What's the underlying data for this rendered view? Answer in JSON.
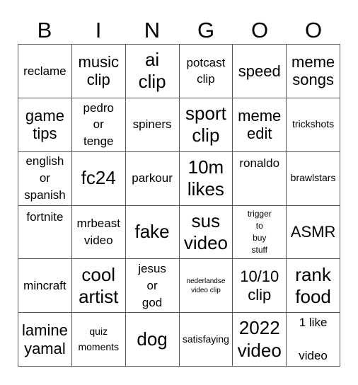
{
  "header": [
    "B",
    "I",
    "N",
    "G",
    "O",
    "O"
  ],
  "cells": [
    {
      "text": "reclame",
      "size": "m"
    },
    {
      "text": "music\nclip",
      "size": "l"
    },
    {
      "text": "ai\nclip",
      "size": "xl"
    },
    {
      "text": "potcast\nclip",
      "size": "m"
    },
    {
      "text": "speed",
      "size": "l"
    },
    {
      "text": "meme\nsongs",
      "size": "l"
    },
    {
      "text": "game\ntips",
      "size": "l"
    },
    {
      "text": "pedro\nor\ntenge",
      "size": "m"
    },
    {
      "text": "spiners",
      "size": "m"
    },
    {
      "text": "sport\nclip",
      "size": "xl"
    },
    {
      "text": "meme\nedit",
      "size": "l"
    },
    {
      "text": "trickshots",
      "size": "s"
    },
    {
      "text": "english\nor\nspanish",
      "size": "m"
    },
    {
      "text": "fc24",
      "size": "xl"
    },
    {
      "text": "parkour",
      "size": "m"
    },
    {
      "text": "10m\nlikes",
      "size": "xl"
    },
    {
      "text": "ronaldo",
      "size": "m",
      "valign": "top"
    },
    {
      "text": "brawlstars",
      "size": "s"
    },
    {
      "text": "fortnite",
      "size": "m",
      "valign": "top"
    },
    {
      "text": "mrbeast\nvideo",
      "size": "m"
    },
    {
      "text": "fake",
      "size": "xl"
    },
    {
      "text": "sus\nvideo",
      "size": "xl"
    },
    {
      "text": "trigger\nto\nbuy\nstuff",
      "size": "s-tight"
    },
    {
      "text": "ASMR",
      "size": "l"
    },
    {
      "text": "mincraft",
      "size": "m"
    },
    {
      "text": "cool\nartist",
      "size": "xl"
    },
    {
      "text": "jesus\nor\ngod",
      "size": "m"
    },
    {
      "text": "nederlandse\nvideo clip",
      "size": "xs"
    },
    {
      "text": "10/10\nclip",
      "size": "l"
    },
    {
      "text": "rank\nfood",
      "size": "xl"
    },
    {
      "text": "lamine\nyamal",
      "size": "l"
    },
    {
      "text": "quiz\nmoments",
      "size": "s"
    },
    {
      "text": "dog",
      "size": "xl"
    },
    {
      "text": "satisfaying",
      "size": "s"
    },
    {
      "text": "2022\nvideo",
      "size": "xl"
    },
    {
      "text": "1 like\n\nvideo",
      "size": "m"
    }
  ]
}
